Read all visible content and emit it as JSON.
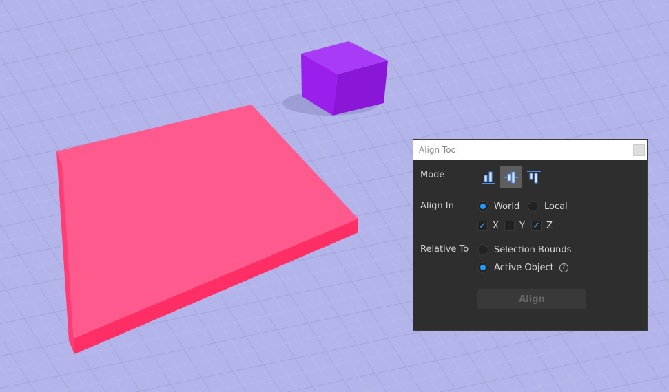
{
  "panel": {
    "title": "Align Tool",
    "mode_label": "Mode",
    "mode_buttons": [
      {
        "name": "align-min-icon",
        "selected": false
      },
      {
        "name": "align-center-icon",
        "selected": true
      },
      {
        "name": "align-max-icon",
        "selected": false
      }
    ],
    "align_in_label": "Align In",
    "align_in_options": [
      {
        "label": "World",
        "selected": true
      },
      {
        "label": "Local",
        "selected": false
      }
    ],
    "axes": [
      {
        "label": "X",
        "checked": true
      },
      {
        "label": "Y",
        "checked": false
      },
      {
        "label": "Z",
        "checked": true
      }
    ],
    "relative_to_label": "Relative To",
    "relative_to_options": [
      {
        "label": "Selection Bounds",
        "selected": false
      },
      {
        "label": "Active Object",
        "selected": true
      }
    ],
    "help_glyph": "?",
    "check_glyph": "✓",
    "align_button": "Align"
  },
  "colors": {
    "accent": "#1e9bff",
    "slab": "#ff4f86",
    "cube": "#9b1ff0"
  }
}
